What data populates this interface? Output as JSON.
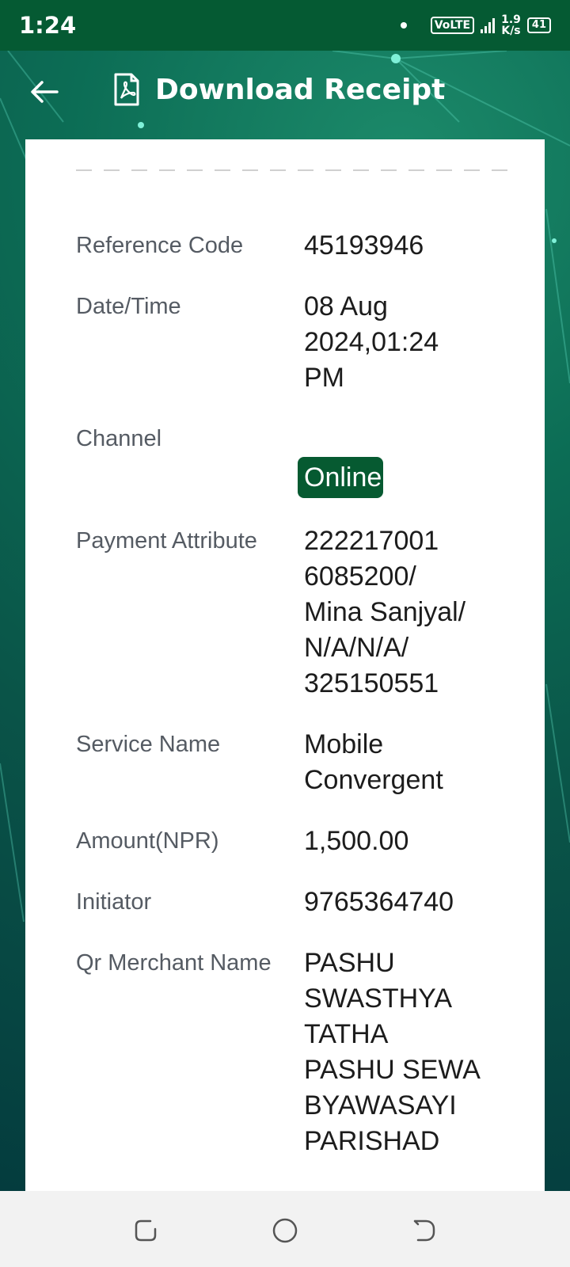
{
  "status": {
    "time": "1:24",
    "volte": "VoLTE",
    "speed_value": "1.9",
    "speed_unit": "K/s",
    "battery": "41"
  },
  "appbar": {
    "title": "Download Receipt",
    "back_icon": "arrow-left-icon",
    "title_icon": "pdf-file-icon"
  },
  "receipt": {
    "rows": [
      {
        "label": "Reference Code",
        "value": "45193946"
      },
      {
        "label": "Date/Time",
        "value": "08 Aug\n2024,01:24\nPM"
      },
      {
        "label": "Channel",
        "value": "Online"
      },
      {
        "label": "Payment\nAttribute",
        "value": "222217001\n6085200/\nMina Sanjyal/\nN/A/N/A/\n325150551"
      },
      {
        "label": "Service Name",
        "value": "Mobile\nConvergent"
      },
      {
        "label": "Amount(NPR)",
        "value": "1,500.00"
      },
      {
        "label": "Initiator",
        "value": "9765364740"
      },
      {
        "label": "Qr Merchant\nName",
        "value": "PASHU\nSWASTHYA\nTATHA\nPASHU SEWA\nBYAWASAYI\nPARISHAD"
      }
    ]
  },
  "colors": {
    "status_bar": "#055a33",
    "badge": "#065a31",
    "label": "#555b63",
    "value": "#1c1c1c"
  }
}
